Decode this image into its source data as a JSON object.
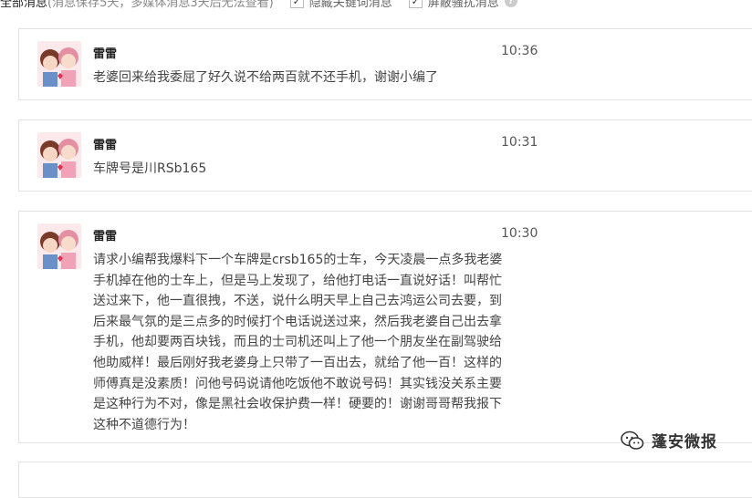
{
  "header": {
    "title": "全部消息",
    "note": "(消息保存5天，多媒体消息3天后无法查看)",
    "hide_keywords": {
      "label": "隐藏关键词消息",
      "checked": true
    },
    "block_spam": {
      "label": "屏蔽骚扰消息",
      "checked": true
    },
    "help": "?"
  },
  "messages": [
    {
      "sender": "雷雷",
      "time": "10:36",
      "text": "老婆回来给我委屈了好久说不给两百就不还手机，谢谢小编了"
    },
    {
      "sender": "雷雷",
      "time": "10:31",
      "text": "车牌号是川RSb165"
    },
    {
      "sender": "雷雷",
      "time": "10:30",
      "text": "请求小编帮我爆料下一个车牌是crsb165的士车，今天凌晨一点多我老婆手机掉在他的士车上，但是马上发现了，给他打电话一直说好话！叫帮忙送过来下，他一直很拽，不送，说什么明天早上自己去鸿运公司去要，到后来最气氛的是三点多的时候打个电话说送过来，然后我老婆自己出去拿手机，他却要两百块钱，而且的士司机还叫上了他一个朋友坐在副驾驶给他助威样！最后刚好我老婆身上只带了一百出去，就给了他一百！这样的师傅真是没素质！问他号码说请他吃饭他不敢说号码！其实钱没关系主要是这种行为不对，像是黑社会收保护费一样！硬要的！谢谢哥哥帮我报下这种不道德行为！"
    }
  ],
  "watermark": {
    "label": "蓬安微报",
    "icon": "wechat-icon"
  }
}
